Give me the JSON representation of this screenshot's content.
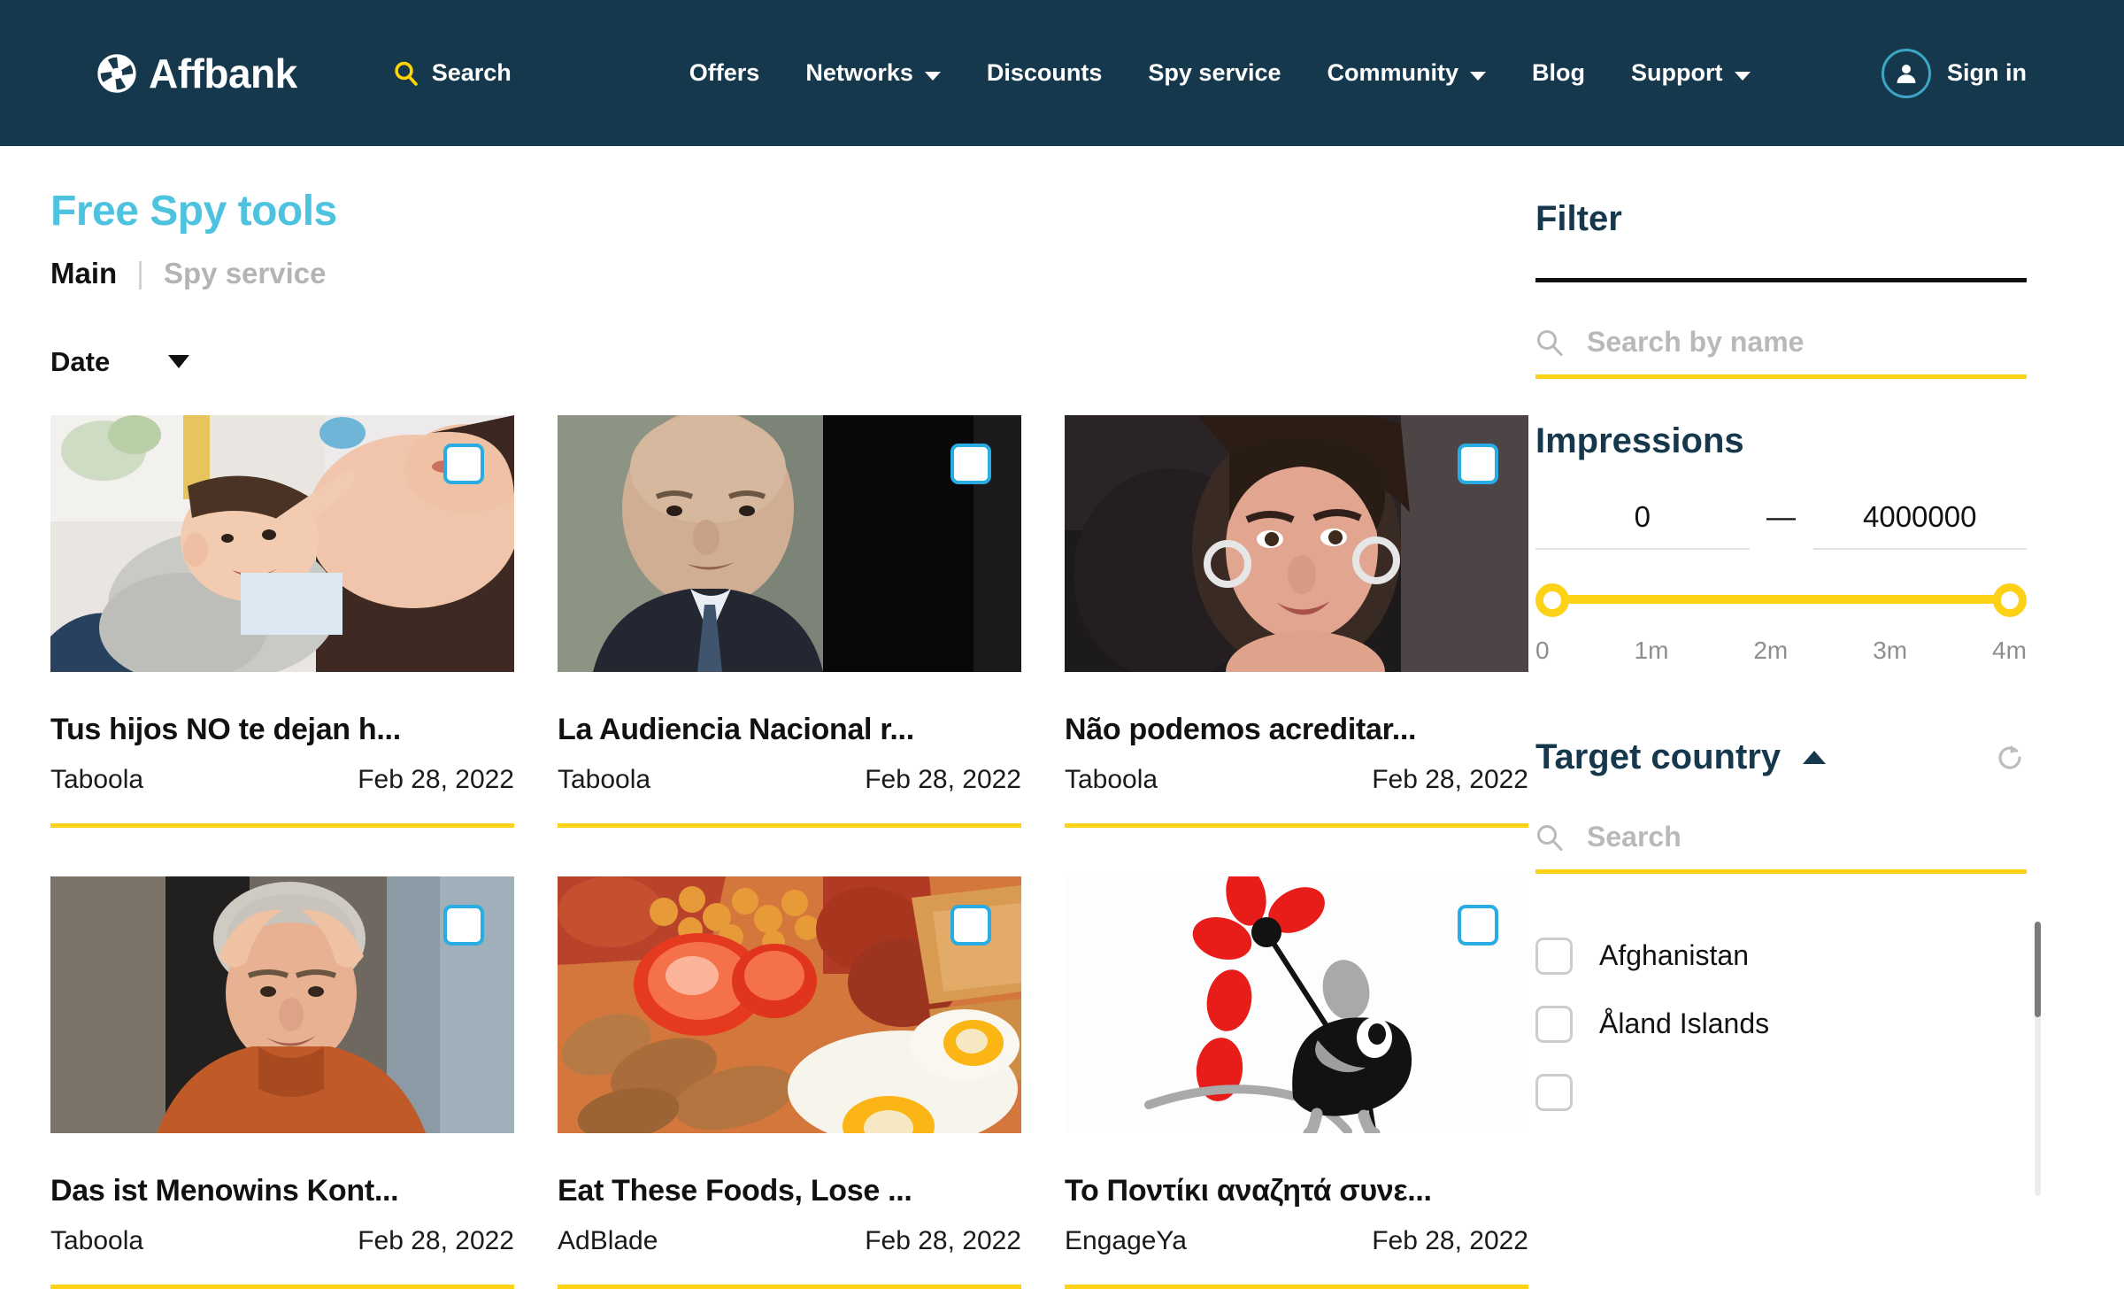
{
  "header": {
    "logo_text": "Affbank",
    "logo_icon": "aperture-icon",
    "search_label": "Search",
    "search_icon": "search-icon",
    "nav_items": [
      {
        "label": "Offers",
        "has_caret": false
      },
      {
        "label": "Networks",
        "has_caret": true
      },
      {
        "label": "Discounts",
        "has_caret": false
      },
      {
        "label": "Spy service",
        "has_caret": false
      },
      {
        "label": "Community",
        "has_caret": true
      },
      {
        "label": "Blog",
        "has_caret": false
      },
      {
        "label": "Support",
        "has_caret": true
      }
    ],
    "signin_label": "Sign in",
    "account_icon": "user-icon",
    "background_color": "#16384d"
  },
  "page": {
    "title": "Free Spy tools",
    "title_color": "#4ec3e0",
    "breadcrumb": {
      "root": "Main",
      "separator": "|",
      "current": "Spy service"
    },
    "sort": {
      "label": "Date",
      "icon": "chevron-down-icon"
    }
  },
  "cards": [
    {
      "title": "Tus hijos NO te dejan h...",
      "network": "Taboola",
      "date": "Feb 28, 2022",
      "image": "mother-and-child-photo",
      "checked": false
    },
    {
      "title": "La Audiencia Nacional r...",
      "network": "Taboola",
      "date": "Feb 28, 2022",
      "image": "bald-man-in-suit-photo",
      "checked": false
    },
    {
      "title": "Não podemos acreditar...",
      "network": "Taboola",
      "date": "Feb 28, 2022",
      "image": "woman-with-earrings-photo",
      "checked": false
    },
    {
      "title": "Das ist Menowins Kont...",
      "network": "Taboola",
      "date": "Feb 28, 2022",
      "image": "man-hands-on-head-photo",
      "checked": false
    },
    {
      "title": "Eat These Foods, Lose ...",
      "network": "AdBlade",
      "date": "Feb 28, 2022",
      "image": "english-breakfast-photo",
      "checked": false
    },
    {
      "title": "Το Ποντίκι αναζητά συνε...",
      "network": "EngageYa",
      "date": "Feb 28, 2022",
      "image": "cartoon-mouse-pinwheel-illustration",
      "checked": false
    }
  ],
  "filter": {
    "title": "Filter",
    "name_search": {
      "placeholder": "Search by name",
      "value": "",
      "icon": "search-icon"
    },
    "impressions": {
      "title": "Impressions",
      "min_value": "0",
      "max_value": "4000000",
      "dash": "—",
      "ticks": [
        "0",
        "1m",
        "2m",
        "3m",
        "4m"
      ]
    },
    "target_country": {
      "title": "Target country",
      "collapse_icon": "chevron-up-icon",
      "reset_icon": "refresh-icon",
      "search": {
        "placeholder": "Search",
        "value": "",
        "icon": "search-icon"
      },
      "options": [
        {
          "label": "Afghanistan",
          "checked": false
        },
        {
          "label": "Åland Islands",
          "checked": false
        }
      ]
    },
    "accent_color": "#fcd116",
    "heading_color": "#16384d"
  }
}
